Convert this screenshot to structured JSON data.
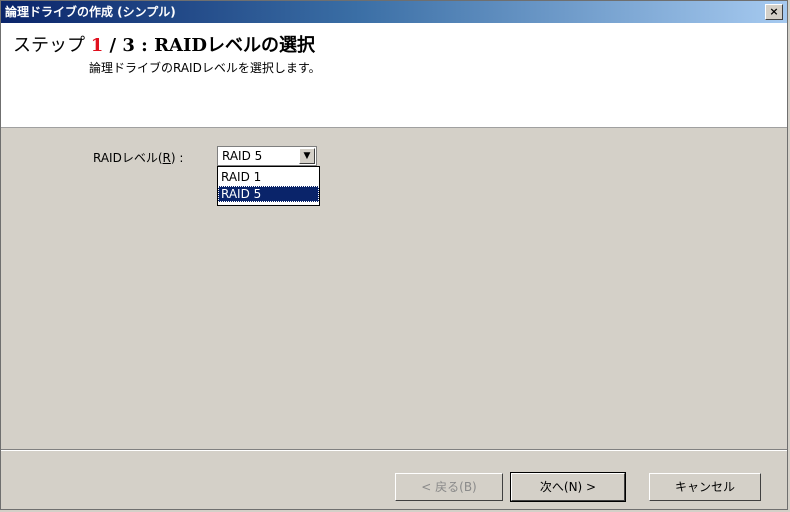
{
  "window": {
    "title": "論理ドライブの作成 (シンプル)",
    "close_label": "×"
  },
  "header": {
    "step_prefix": "ステップ ",
    "step_current": "1",
    "step_rest": " / 3 : RAIDレベルの選択",
    "subtitle": "論理ドライブのRAIDレベルを選択します。"
  },
  "form": {
    "raid_label_prefix": "RAIDレベル(",
    "raid_label_mnemonic": "R",
    "raid_label_suffix": ") :",
    "selected_value": "RAID 5",
    "options": [
      "RAID 1",
      "RAID 5"
    ],
    "highlighted_option": "RAID 5"
  },
  "buttons": {
    "back": "< 戻る(B)",
    "next": "次へ(N) >",
    "cancel": "キャンセル"
  }
}
